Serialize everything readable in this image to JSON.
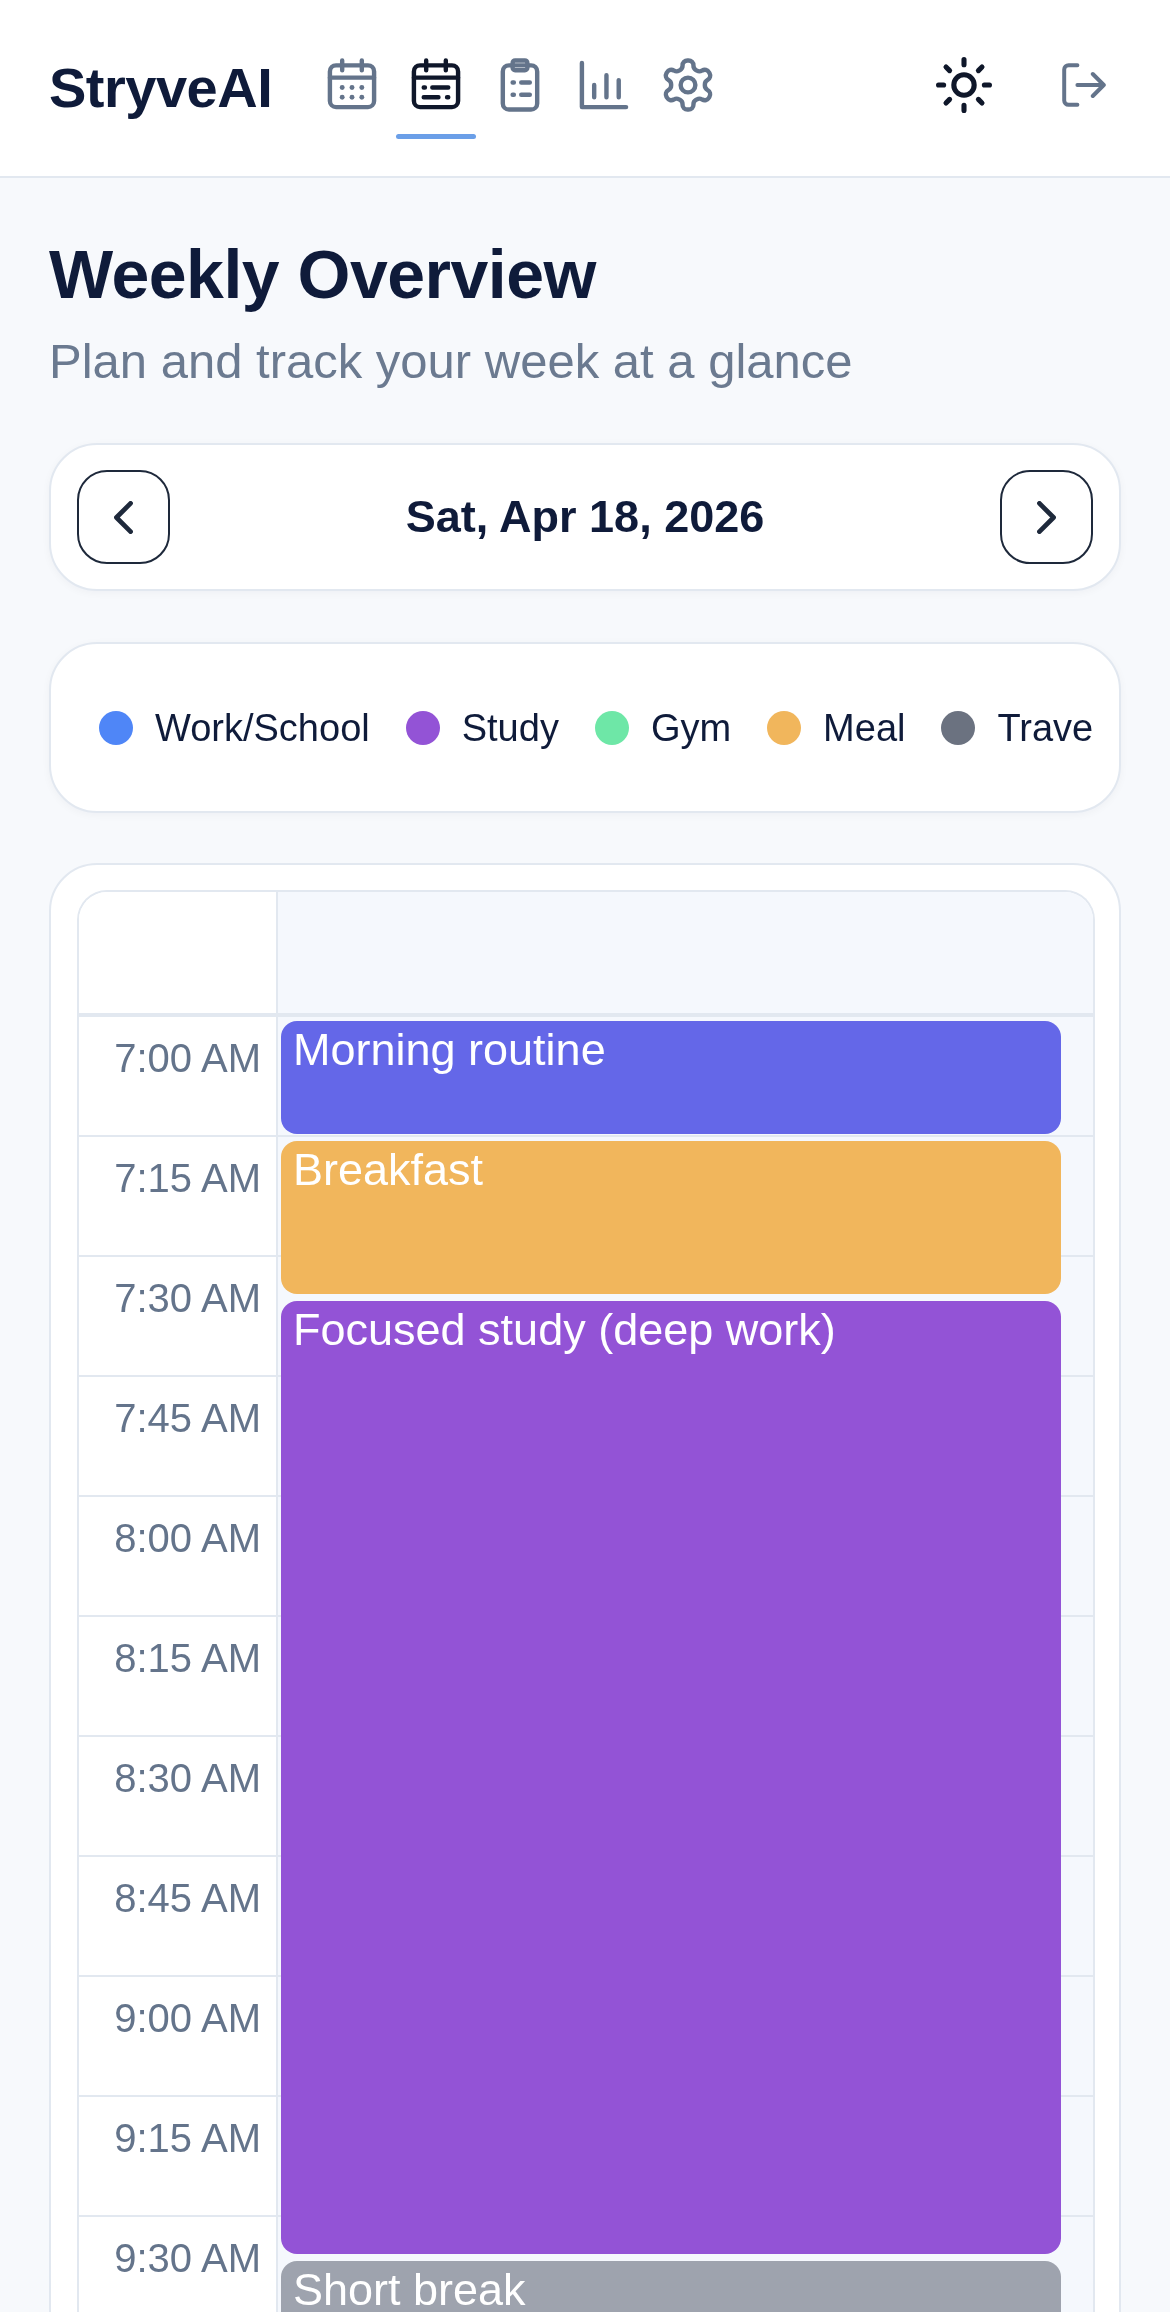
{
  "header": {
    "logo": "StryveAI",
    "tabs": [
      {
        "kind": "calendar",
        "selected": false
      },
      {
        "kind": "schedule",
        "selected": true
      },
      {
        "kind": "checklist",
        "selected": false
      },
      {
        "kind": "chart",
        "selected": false
      },
      {
        "kind": "settings",
        "selected": false
      }
    ]
  },
  "page": {
    "title": "Weekly Overview",
    "subtitle": "Plan and track your week at a glance"
  },
  "date_nav": {
    "date": "Sat, Apr 18, 2026"
  },
  "legend": {
    "items": [
      {
        "label": "Work/School",
        "color": "#4f86f7"
      },
      {
        "label": "Study",
        "color": "#9353d6"
      },
      {
        "label": "Gym",
        "color": "#6ee7a7"
      },
      {
        "label": "Meal",
        "color": "#f1b65c"
      },
      {
        "label": "Trave",
        "color": "#6b7280"
      }
    ]
  },
  "calendar": {
    "times": [
      "7:00 AM",
      "7:15 AM",
      "7:30 AM",
      "7:45 AM",
      "8:00 AM",
      "8:15 AM",
      "8:30 AM",
      "8:45 AM",
      "9:00 AM",
      "9:15 AM",
      "9:30 AM"
    ],
    "events": [
      {
        "title": "Morning routine",
        "color": "#6467e8"
      },
      {
        "title": "Breakfast",
        "color": "#f1b65c"
      },
      {
        "title": "Focused study (deep work)",
        "color": "#9353d6"
      },
      {
        "title": "Short break",
        "color": "#9ea3ae"
      }
    ]
  }
}
